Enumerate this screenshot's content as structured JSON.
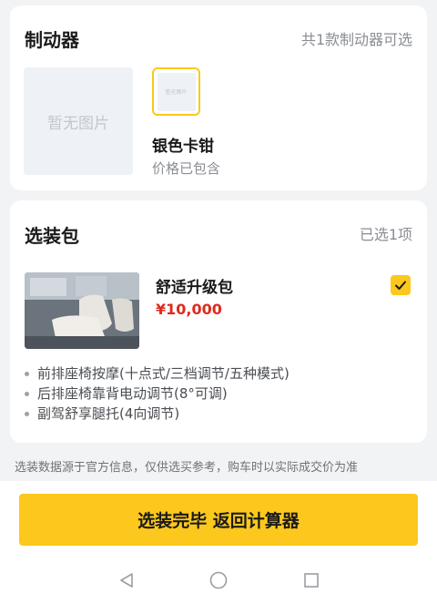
{
  "brake_section": {
    "title": "制动器",
    "count_text": "共1款制动器可选",
    "placeholder_large": "暂无图片",
    "placeholder_small": "暂无图片",
    "option_name": "银色卡钳",
    "option_note": "价格已包含"
  },
  "package_section": {
    "title": "选装包",
    "selected_text": "已选1项",
    "package_name": "舒适升级包",
    "package_price": "¥10,000",
    "features": [
      "前排座椅按摩(十点式/三档调节/五种模式)",
      "后排座椅靠背电动调节(8°可调)",
      "副驾舒享腿托(4向调节)"
    ]
  },
  "disclaimer": "选装数据源于官方信息，仅供选买参考，购车时以实际成交价为准",
  "cta_label": "选装完毕 返回计算器",
  "colors": {
    "accent": "#fcc81d",
    "price": "#e0291d",
    "background": "#f2f3f5"
  },
  "icons": {
    "check": "check-icon",
    "back": "nav-back-icon",
    "home": "nav-home-icon",
    "recents": "nav-recents-icon"
  }
}
